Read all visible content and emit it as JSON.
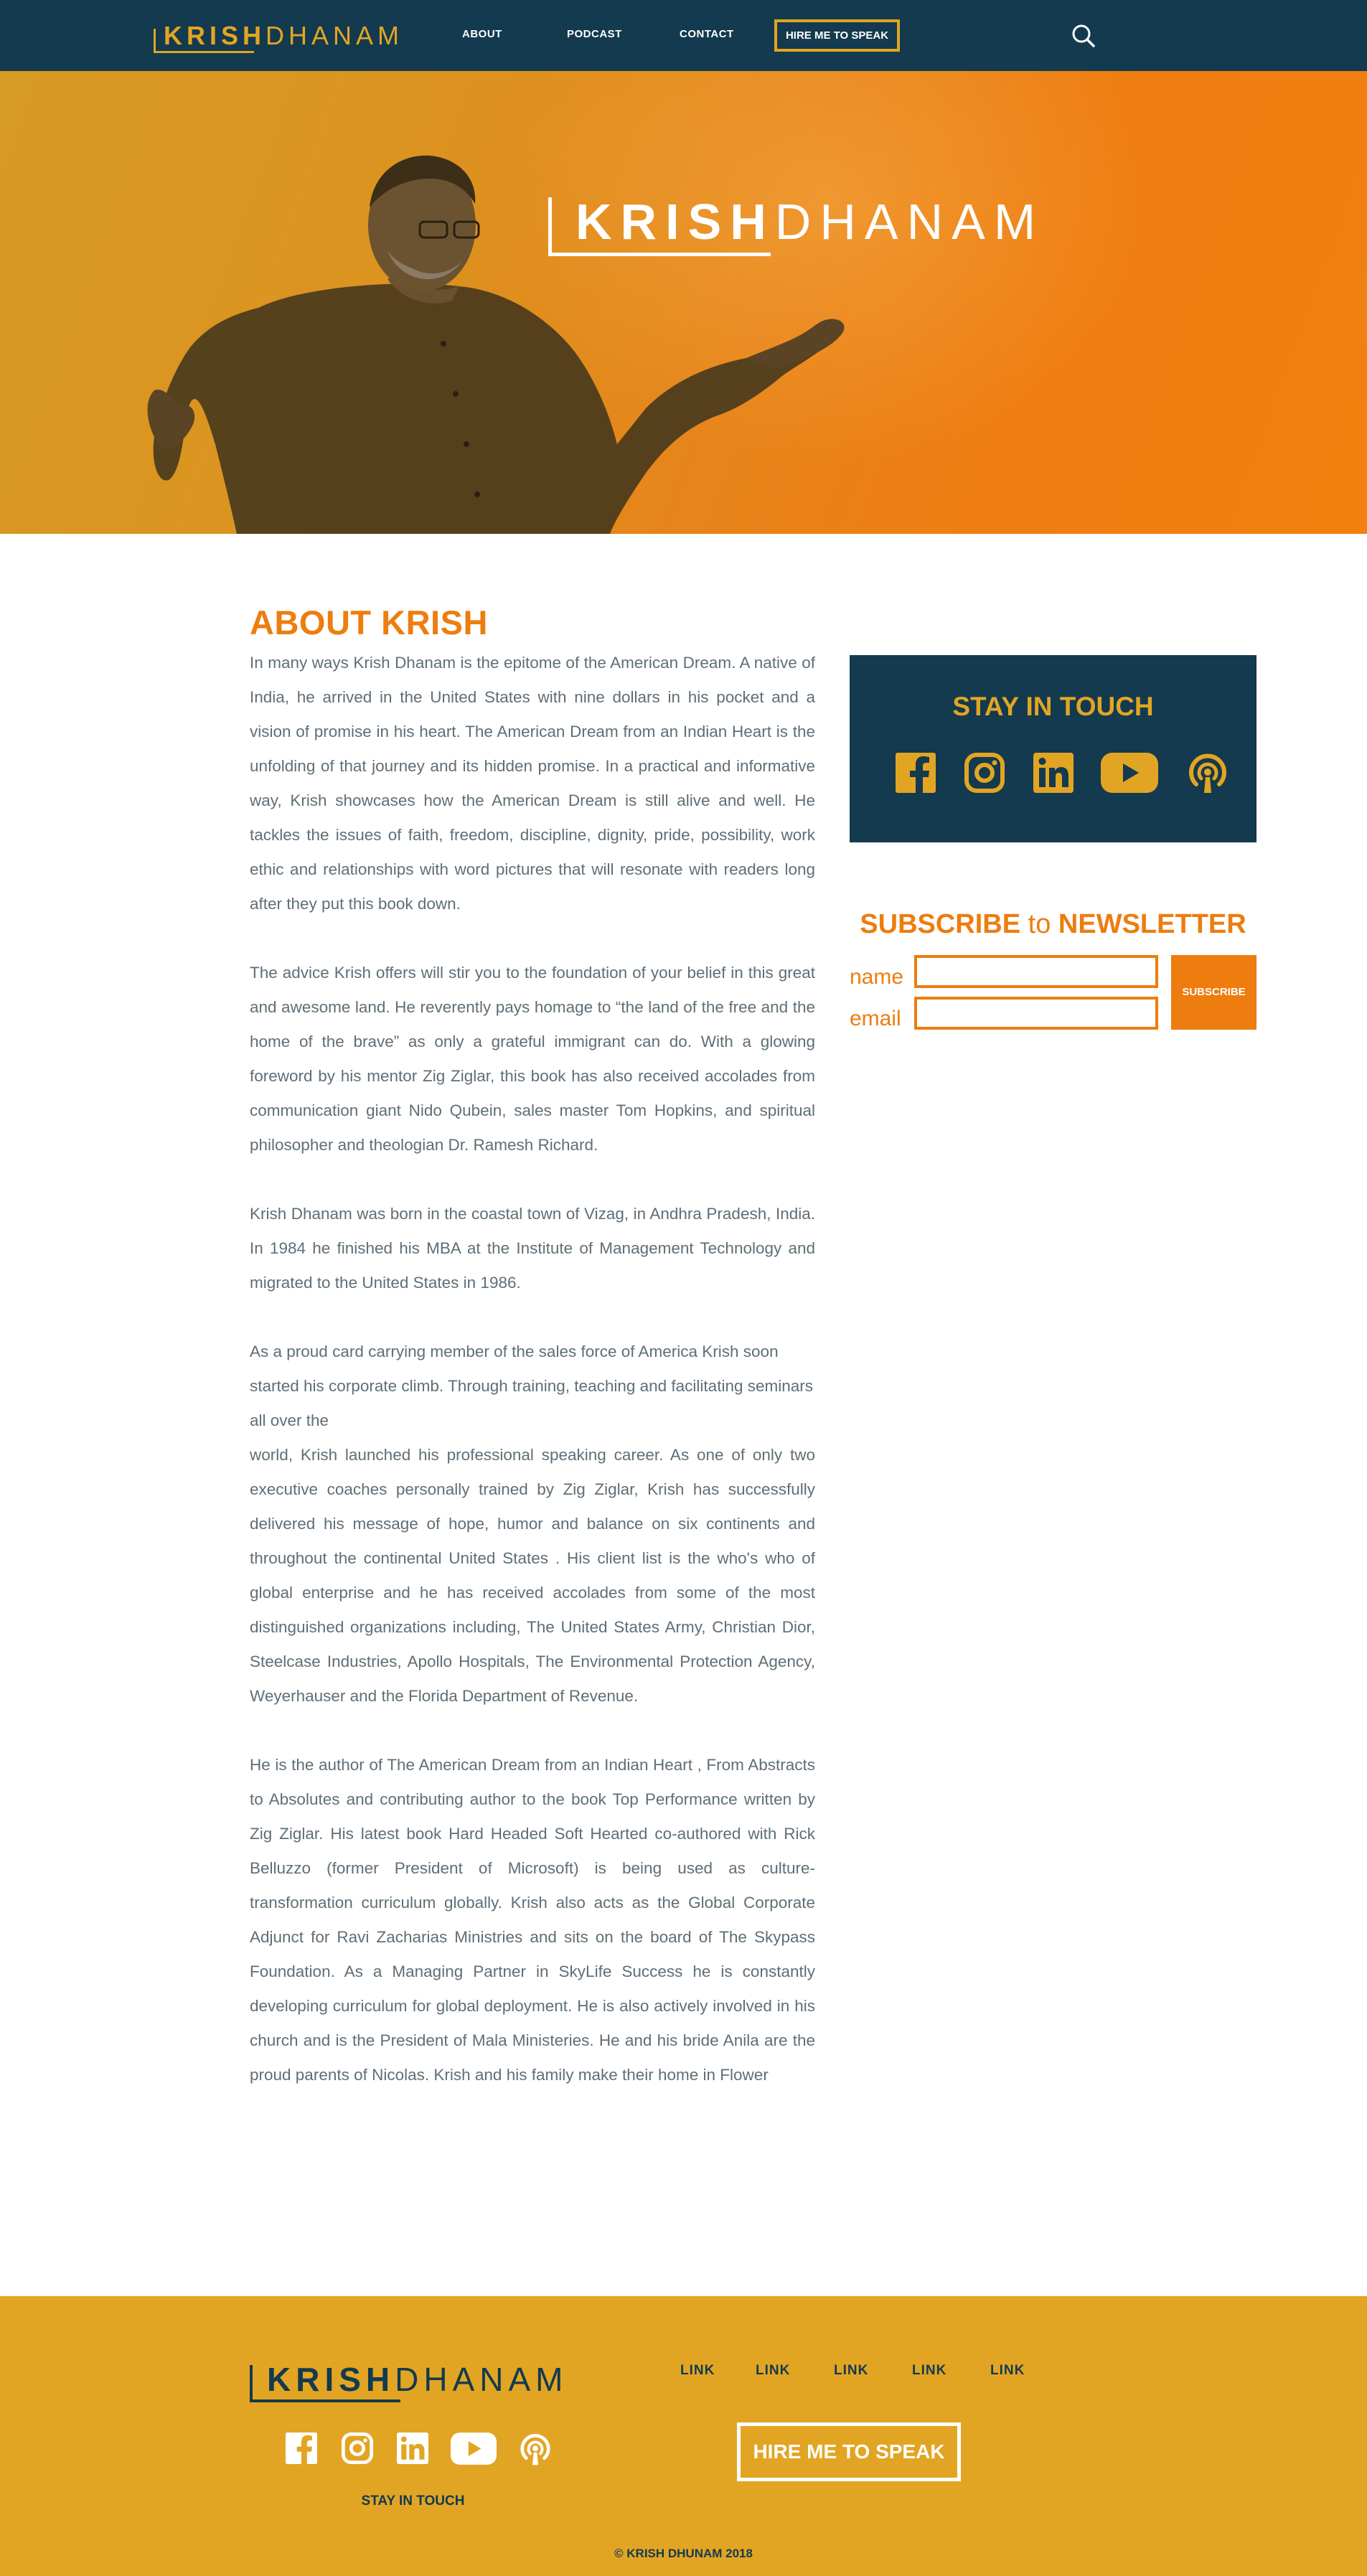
{
  "brand": {
    "first": "KRISH",
    "last": "DHANAM"
  },
  "nav": {
    "links": [
      "ABOUT",
      "PODCAST",
      "CONTACT"
    ],
    "cta": "HIRE ME TO SPEAK"
  },
  "about": {
    "title": "ABOUT KRISH",
    "paragraphs": [
      "In many ways Krish Dhanam is the epitome of the American Dream. A native of India, he arrived in the United States with nine dollars in his pocket and a vision of promise in his heart. The American Dream from an Indian Heart is the unfolding of that journey and its hidden promise. In a practical and informative way, Krish showcases how the American Dream is still alive and well. He tackles the issues of faith, freedom, discipline, dignity, pride, possibility, work ethic and relationships with word pictures that will resonate with readers long after they put this book down.",
      "The advice Krish offers will stir you to the foundation of your belief in this great and awesome land. He reverently pays homage to “the land of the free and the home of the brave” as only a grateful immigrant can do. With a glowing foreword by his mentor Zig Ziglar, this book has also received accolades from communication giant Nido Qubein, sales master Tom Hopkins, and spiritual philosopher and theologian Dr. Ramesh Richard.",
      "Krish Dhanam was born in the coastal town of Vizag, in Andhra Pradesh, India.  In 1984 he finished his MBA at the Institute of Management Technology and migrated to the United States in 1986.",
      "As a  proud card carrying member of the sales force of America Krish soon started his corporate climb. Through training, teaching and facilitating seminars all over the",
      "world, Krish launched his professional speaking career. As one of only two executive coaches personally trained by Zig Ziglar, Krish has successfully delivered his message of hope, humor and balance on six continents and throughout the continental United States . His client list is the who's who of global enterprise and he has received accolades from some of the most distinguished organizations including, The United States Army, Christian Dior, Steelcase Industries, Apollo Hospitals, The Environmental Protection Agency, Weyerhauser and the Florida Department of Revenue.",
      "He is the author of The American Dream from an Indian Heart , From Abstracts to Absolutes and contributing author to the book Top Performance written by Zig Ziglar. His latest book Hard Headed Soft Hearted co-authored with Rick Belluzzo (former President of Microsoft) is being used as culture-transformation curriculum globally. Krish also acts as the Global Corporate Adjunct for Ravi Zacharias Ministries and sits on the board of The Skypass Foundation. As a Managing Partner in SkyLife Success he is constantly developing curriculum for global deployment. He is also actively involved in his church and is the President of Mala Ministeries. He and his bride Anila are the proud parents of Nicolas. Krish and his family make their home in Flower"
    ]
  },
  "sidebar": {
    "touch_title": "STAY IN TOUCH",
    "social_icons": [
      "facebook-icon",
      "instagram-icon",
      "linkedin-icon",
      "youtube-icon",
      "podcast-icon"
    ],
    "subscribe": {
      "word1": "SUBSCRIBE",
      "word2": "to",
      "word3": "NEWSLETTER",
      "name_label": "name",
      "email_label": "email",
      "name_value": "",
      "email_value": "",
      "button": "SUBSCRIBE"
    }
  },
  "footer": {
    "links": [
      "LINK",
      "LINK",
      "LINK",
      "LINK",
      "LINK"
    ],
    "cta": "HIRE ME TO SPEAK",
    "touch_label": "STAY IN TOUCH",
    "copyright": "© KRISH DHUNAM 2018"
  },
  "colors": {
    "navy": "#133a4e",
    "gold": "#e2a523",
    "orange": "#ed7d0e",
    "body_text": "#5f6e77",
    "white": "#ffffff"
  }
}
